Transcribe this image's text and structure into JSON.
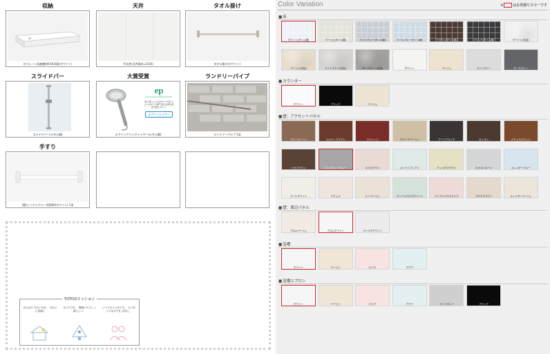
{
  "left": {
    "items": [
      {
        "title": "収納",
        "caption": "セパレート収納棚(W:40)3段(ホワイト)"
      },
      {
        "title": "天井",
        "caption": "平天井(天井高H=2150)"
      },
      {
        "title": "タオル掛け",
        "caption": "タオル掛け(ホワイト)"
      },
      {
        "title": "スライドバー",
        "caption": "スライドバー(メタル調)"
      },
      {
        "title": "大賞受賞",
        "caption": "エアインクリックシャワー(メタル調)"
      },
      {
        "title": "ランドリーパイプ",
        "caption": "ランドリーパイプ 1本"
      },
      {
        "title": "手すり",
        "caption": "(壁)インテリアバー(I型800ホワイト) 1本"
      }
    ],
    "award": {
      "logo": "ep",
      "subtitle": "eco product awards 2013",
      "text": "第10回 エコプロダクツ大賞 エコプロダクツ部門 国土交通大臣賞 受賞しました",
      "badge": "エアインシャワー"
    },
    "mission": {
      "title": "TOTOのミッション",
      "cols": [
        "みんなの きれいなを、 きれいに快適に",
        "きいたりを、 環境にやさしく 暮らしへ。",
        "いつでもいつまでも、 人とめぐりながりを 大切に。"
      ]
    }
  },
  "right": {
    "title": "Color Variation",
    "note_prefix": "※",
    "note_suffix": "はお見積りカラーです",
    "sections": [
      {
        "name": "床",
        "swatches": [
          {
            "label": "ホワイト(タイル調)",
            "color": "#eef2f6",
            "pattern": "tile",
            "selected": true
          },
          {
            "label": "ベージュ(タイル調)",
            "color": "#e6e3dc",
            "pattern": "tile"
          },
          {
            "label": "ライトグレー(タイル調)",
            "color": "#c9ced5",
            "pattern": "tile"
          },
          {
            "label": "ペールブルー(タイル調)",
            "color": "#cfdbe3",
            "pattern": "tile"
          },
          {
            "label": "ブラウン(タイル調)",
            "color": "#4a3a33",
            "pattern": "tile",
            "dark": true
          },
          {
            "label": "ブラック(タイル調)",
            "color": "#3a3a3c",
            "pattern": "tile",
            "dark": true
          },
          {
            "label": "ホワイト(石目)",
            "color": "#f0eff0",
            "pattern": "stone"
          },
          {
            "label": "ベージュ(石目)",
            "color": "#e7ddcc",
            "pattern": "stone"
          },
          {
            "label": "ライトグレー(石目)",
            "color": "#d4d3d1",
            "pattern": "stone"
          },
          {
            "label": "ダークグレー(石目)",
            "color": "#a4a2a0",
            "pattern": "stone"
          },
          {
            "label": "ホワイト",
            "color": "#f4f4f2",
            "pattern": "plain"
          },
          {
            "label": "ベージュ",
            "color": "#ede3cf",
            "pattern": "plain"
          },
          {
            "label": "ライトグレー",
            "color": "#dcdcdc",
            "pattern": "plain"
          },
          {
            "label": "ダークグレー",
            "color": "#646568",
            "pattern": "plain",
            "dark": true
          }
        ]
      },
      {
        "name": "カウンター",
        "swatches": [
          {
            "label": "ホワイト",
            "color": "#fbfbfb",
            "selected": true
          },
          {
            "label": "ブラック",
            "color": "#0a0a0a",
            "dark": true
          },
          {
            "label": "ベージュ",
            "color": "#ece4d4"
          }
        ]
      },
      {
        "name": "壁：アクセントパネル",
        "swatches": [
          {
            "label": "ブルーストーン",
            "color": "#8b6a55",
            "dark": true
          },
          {
            "label": "メルティブラウン",
            "color": "#6b3a2c",
            "dark": true
          },
          {
            "label": "ラミレッド",
            "color": "#7a2c28",
            "dark": true
          },
          {
            "label": "ホルミアベージュ",
            "color": "#cfbfa5"
          },
          {
            "label": "アーミブラック",
            "color": "#3a3533",
            "dark": true
          },
          {
            "label": "セイラン",
            "color": "#4a3a30",
            "dark": true
          },
          {
            "label": "ナチュラルウッド",
            "color": "#7a4a2c",
            "dark": true
          },
          {
            "label": "ジオブラウン",
            "color": "#5a4336",
            "dark": true
          },
          {
            "label": "クレアライトグレー",
            "color": "#a6a6a6",
            "dark": true,
            "selected": true
          },
          {
            "label": "キャロラウン",
            "color": "#eadad6"
          },
          {
            "label": "ストライプシアン",
            "color": "#dfeaeb"
          },
          {
            "label": "ティルダブラウン",
            "color": "#e4e1c4"
          },
          {
            "label": "ネオストローン",
            "color": "#d4d7da"
          },
          {
            "label": "メレンダーブルー",
            "color": "#d8e4ee"
          },
          {
            "label": "ブーケホワイト",
            "color": "#f1eee8"
          },
          {
            "label": "ナチュル",
            "color": "#eee6dd"
          },
          {
            "label": "ルーベージュ",
            "color": "#ebe1d7"
          },
          {
            "label": "マリアルアロマグリーン",
            "color": "#d5e2dc"
          },
          {
            "label": "マリアルアロマピンク",
            "color": "#efdcd8"
          },
          {
            "label": "アロマブラウン",
            "color": "#e4d9cc"
          },
          {
            "label": "メレンダーベージュ",
            "color": "#ece5da"
          }
        ]
      },
      {
        "name": "壁：周辺パネル",
        "swatches": [
          {
            "label": "アロムベージュ",
            "color": "#f1ebe3"
          },
          {
            "label": "アロムホワイト",
            "color": "#f7f7f8",
            "selected": true
          },
          {
            "label": "ペールグホワイト",
            "color": "#ececec"
          }
        ]
      },
      {
        "name": "浴槽",
        "swatches": [
          {
            "label": "ホワイト",
            "color": "#f6f6f6",
            "selected": true
          },
          {
            "label": "ベージュ",
            "color": "#efe6d8"
          },
          {
            "label": "ピンク",
            "color": "#f6e3e2"
          },
          {
            "label": "アクア",
            "color": "#e3eff0"
          }
        ]
      },
      {
        "name": "浴槽エプロン",
        "swatches": [
          {
            "label": "ホワイト",
            "color": "#f6f6f6",
            "selected": true
          },
          {
            "label": "ベージュ",
            "color": "#efe6d8"
          },
          {
            "label": "ピンク",
            "color": "#f6e3e2"
          },
          {
            "label": "アクア",
            "color": "#e3eff0"
          },
          {
            "label": "ライトグレー",
            "color": "#cfcfcf"
          },
          {
            "label": "ブラック",
            "color": "#0a0a0a",
            "dark": true
          }
        ]
      }
    ]
  }
}
